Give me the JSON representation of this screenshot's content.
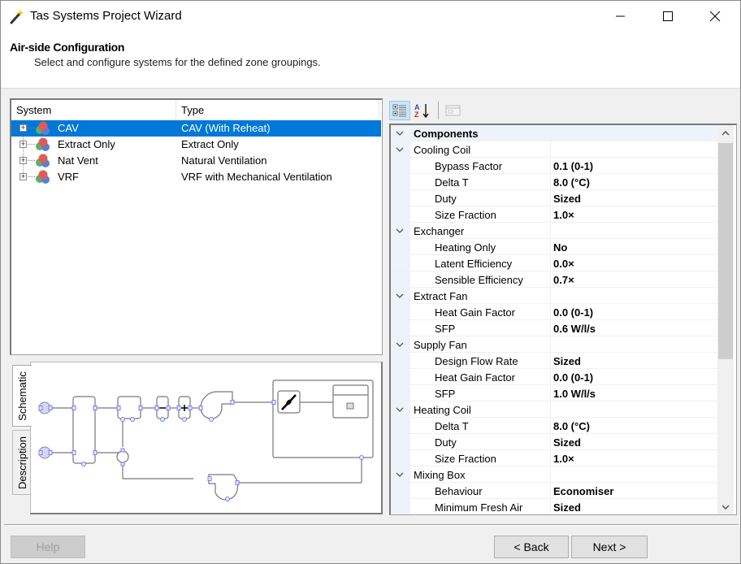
{
  "window": {
    "title": "Tas Systems Project Wizard",
    "controls": {
      "minimize": "minimize-icon",
      "maximize": "maximize-icon",
      "close": "close-icon"
    }
  },
  "header": {
    "title": "Air-side Configuration",
    "subtitle": "Select and configure systems for the defined zone groupings."
  },
  "systems": {
    "columns": {
      "system": "System",
      "type": "Type"
    },
    "rows": [
      {
        "name": "CAV",
        "type": "CAV (With Reheat)",
        "selected": true
      },
      {
        "name": "Extract Only",
        "type": "Extract Only",
        "selected": false
      },
      {
        "name": "Nat Vent",
        "type": "Natural Ventilation",
        "selected": false
      },
      {
        "name": "VRF",
        "type": "VRF with Mechanical Ventilation",
        "selected": false
      }
    ]
  },
  "preview_tabs": {
    "schematic": "Schematic",
    "description": "Description",
    "active": "Schematic"
  },
  "property_grid": {
    "toolbar": {
      "categorized": "categorized-icon",
      "alphabetical": "sort-az-icon",
      "property_pages": "property-pages-icon"
    },
    "rows": [
      {
        "kind": "top",
        "label": "Components"
      },
      {
        "kind": "cat",
        "label": "Cooling Coil"
      },
      {
        "kind": "prop",
        "label": "Bypass Factor",
        "value": "0.1 (0-1)"
      },
      {
        "kind": "prop",
        "label": "Delta T",
        "value": "8.0 (°C)"
      },
      {
        "kind": "prop",
        "label": "Duty",
        "value": "Sized"
      },
      {
        "kind": "prop",
        "label": "Size Fraction",
        "value": "1.0×"
      },
      {
        "kind": "cat",
        "label": "Exchanger"
      },
      {
        "kind": "prop",
        "label": "Heating Only",
        "value": "No"
      },
      {
        "kind": "prop",
        "label": "Latent Efficiency",
        "value": "0.0×"
      },
      {
        "kind": "prop",
        "label": "Sensible Efficiency",
        "value": "0.7×"
      },
      {
        "kind": "cat",
        "label": "Extract Fan"
      },
      {
        "kind": "prop",
        "label": "Heat Gain Factor",
        "value": "0.0 (0-1)"
      },
      {
        "kind": "prop",
        "label": "SFP",
        "value": "0.6 W/l/s"
      },
      {
        "kind": "cat",
        "label": "Supply Fan"
      },
      {
        "kind": "prop",
        "label": "Design Flow Rate",
        "value": "Sized"
      },
      {
        "kind": "prop",
        "label": "Heat Gain Factor",
        "value": "0.0 (0-1)"
      },
      {
        "kind": "prop",
        "label": "SFP",
        "value": "1.0 W/l/s"
      },
      {
        "kind": "cat",
        "label": "Heating Coil"
      },
      {
        "kind": "prop",
        "label": "Delta T",
        "value": "8.0 (°C)"
      },
      {
        "kind": "prop",
        "label": "Duty",
        "value": "Sized"
      },
      {
        "kind": "prop",
        "label": "Size Fraction",
        "value": "1.0×"
      },
      {
        "kind": "cat",
        "label": "Mixing Box"
      },
      {
        "kind": "prop",
        "label": "Behaviour",
        "value": "Economiser"
      },
      {
        "kind": "prop",
        "label": "Minimum Fresh Air",
        "value": "Sized"
      }
    ]
  },
  "footer": {
    "help": "Help",
    "back": "< Back",
    "next": "Next >"
  },
  "colors": {
    "selection": "#0078d7",
    "port": "#7b7bff",
    "port_fill": "#d6d6ff"
  }
}
